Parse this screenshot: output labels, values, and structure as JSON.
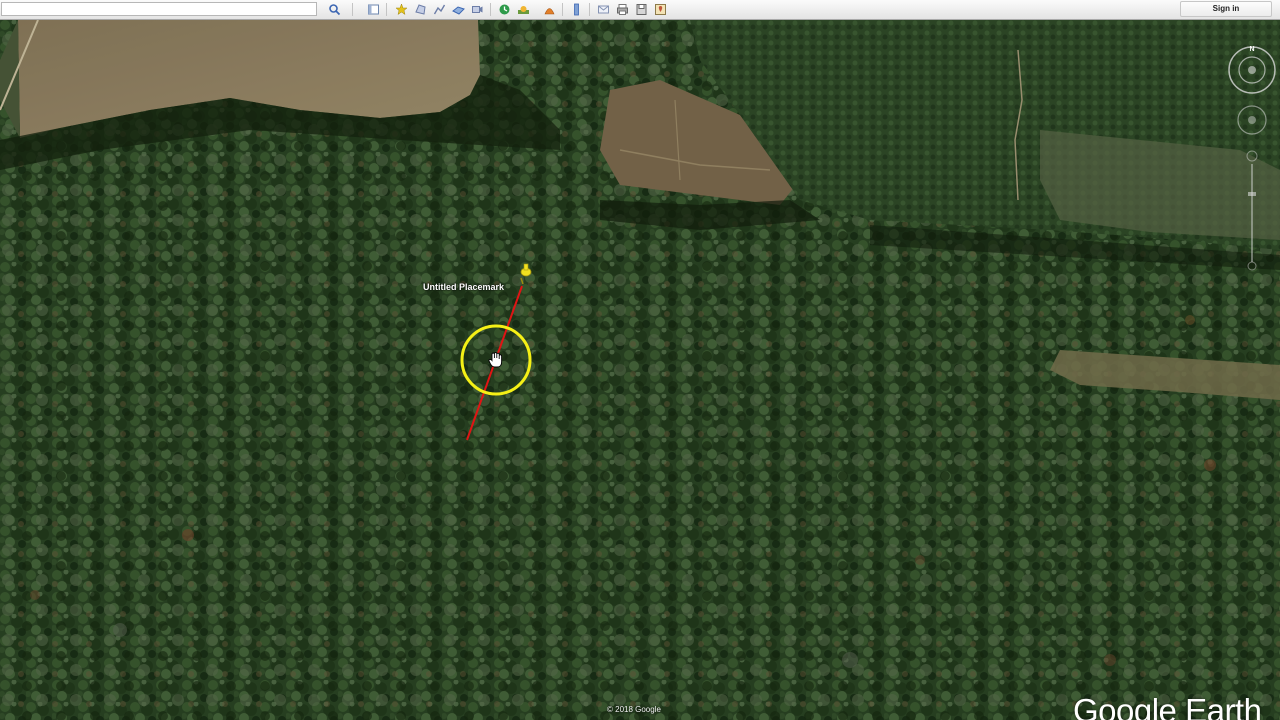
{
  "toolbar": {
    "search_placeholder": "",
    "buttons": [
      {
        "name": "search-button-icon",
        "color": "#5a83c9"
      },
      {
        "name": "sidebar-toggle-icon",
        "color": "#7a93b8"
      },
      {
        "name": "add-placemark-icon",
        "color": "#e3c21a"
      },
      {
        "name": "add-polygon-icon",
        "color": "#8d9ac0"
      },
      {
        "name": "add-path-icon",
        "color": "#8d9ac0"
      },
      {
        "name": "image-overlay-icon",
        "color": "#6a8fc4"
      },
      {
        "name": "record-tour-icon",
        "color": "#8d9ac0"
      },
      {
        "name": "historical-imagery-icon",
        "color": "#2e9a4a"
      },
      {
        "name": "sunlight-icon",
        "color": "#d9a636"
      },
      {
        "name": "switch-to-sky-icon",
        "color": "#e27f2a"
      },
      {
        "name": "ruler-icon",
        "color": "#5a83c9"
      },
      {
        "name": "email-icon",
        "color": "#9aaac8"
      },
      {
        "name": "print-icon",
        "color": "#8a8a8a"
      },
      {
        "name": "save-image-icon",
        "color": "#7a7a7a"
      },
      {
        "name": "view-in-maps-icon",
        "color": "#c0563a"
      }
    ],
    "sign_in_label": "Sign in"
  },
  "map": {
    "placemark_label": "Untitled Placemark",
    "pin_color": "#f2e21f",
    "path_color": "#e01414",
    "cursor_highlight_color": "#f5f016",
    "compass_label": "N"
  },
  "footer": {
    "copyright": "© 2018 Google",
    "brand": "Google Earth"
  }
}
